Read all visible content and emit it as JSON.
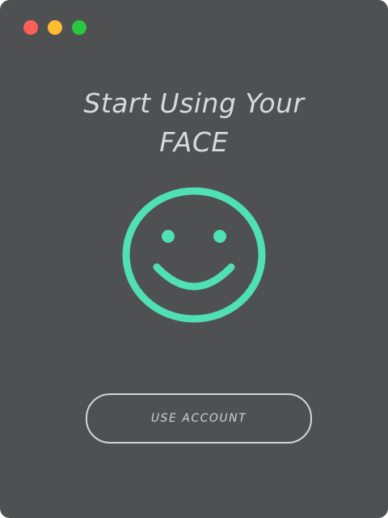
{
  "window": {
    "controls": [
      {
        "name": "close",
        "color": "#fe5f57"
      },
      {
        "name": "minimize",
        "color": "#febc2e"
      },
      {
        "name": "zoom",
        "color": "#28c840"
      }
    ]
  },
  "main": {
    "title_line1": "Start Using Your",
    "title_line2": "FACE",
    "face_icon": "smiley-face-icon",
    "accent_color": "#4fe0b6",
    "button_label": "USE ACCOUNT"
  }
}
